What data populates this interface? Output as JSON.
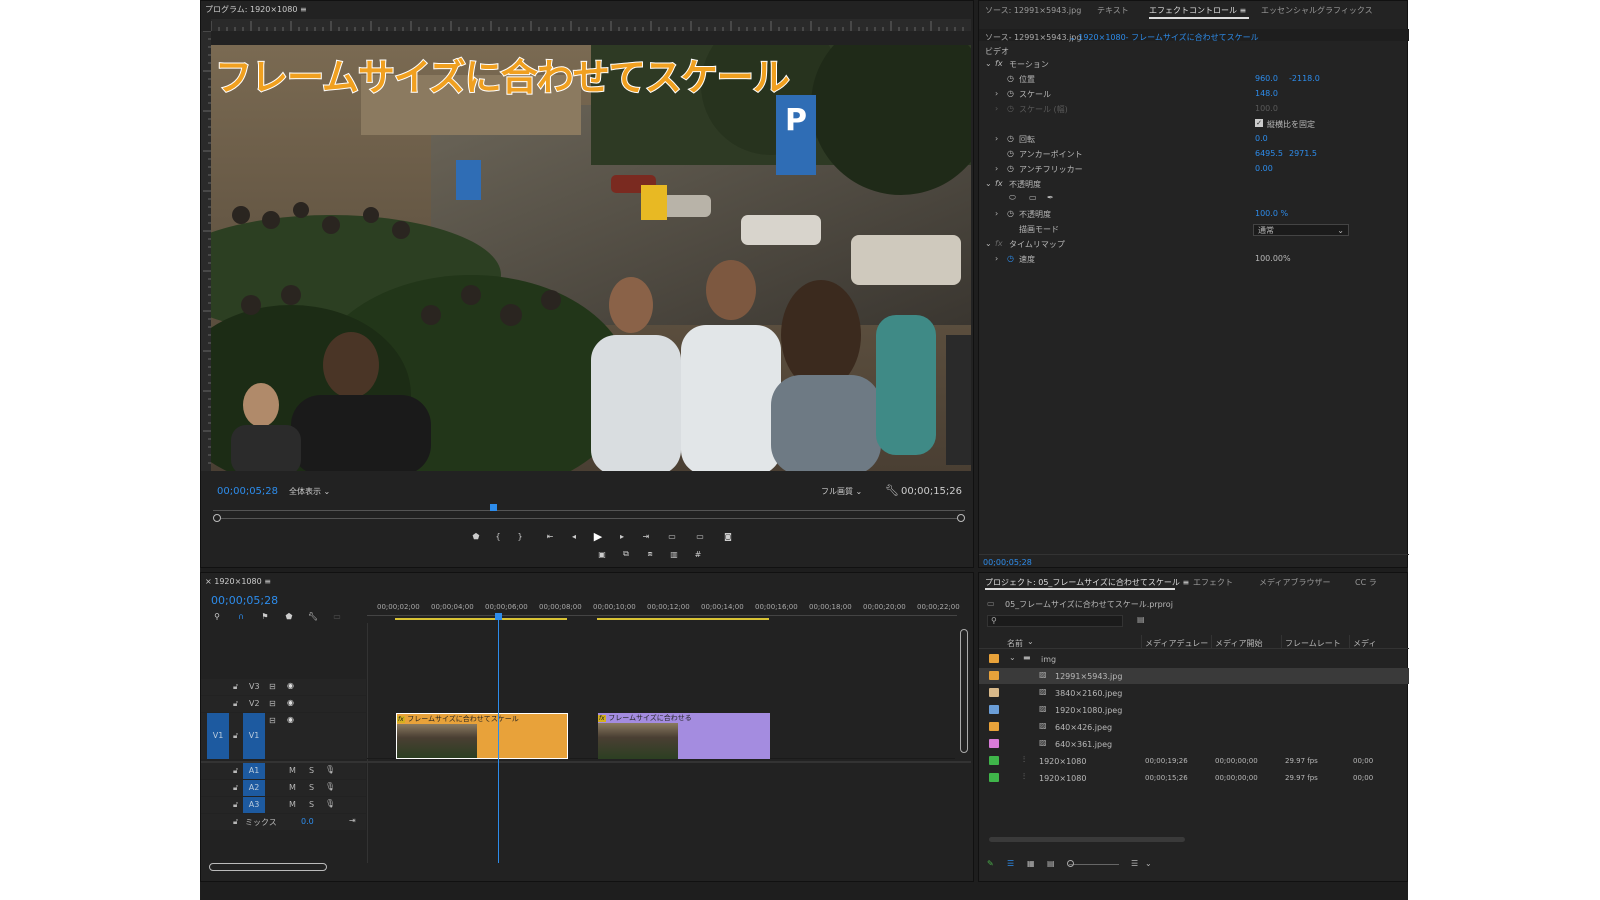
{
  "program": {
    "title": "プログラム: 1920×1080",
    "overlay_text": "フレームサイズに合わせてスケール",
    "timecode": "00;00;05;28",
    "fit_dropdown": "全体表示",
    "quality_dropdown": "フル画質",
    "duration": "00;00;15;26",
    "transport": [
      "marker-icon",
      "in-point-icon",
      "out-point-icon",
      "go-to-in-icon",
      "step-back-icon",
      "play-icon",
      "step-forward-icon",
      "go-to-out-icon",
      "insert-icon",
      "overwrite-icon",
      "export-frame-icon"
    ],
    "transport_row2": [
      "safe-margins-icon",
      "lift-icon",
      "extract-icon",
      "compare-icon",
      "grid-icon"
    ]
  },
  "right_tabs": {
    "source": "ソース: 12991×5943.jpg",
    "text": "テキスト",
    "effect_control": "エフェクトコントロール",
    "essential": "エッセンシャルグラフィックス"
  },
  "effect_controls": {
    "source_label": "ソース- 12991×5943.jpg",
    "sequence_label": "1920×1080- フレームサイズに合わせてスケール",
    "section_video": "ビデオ",
    "motion": "モーション",
    "position_label": "位置",
    "position_x": "960.0",
    "position_y": "-2118.0",
    "scale_label": "スケール",
    "scale_value": "148.0",
    "scale_width_label": "スケール (幅)",
    "scale_width_value": "100.0",
    "uniform_label": "縦横比を固定",
    "rotation_label": "回転",
    "rotation_value": "0.0",
    "anchor_label": "アンカーポイント",
    "anchor_x": "6495.5",
    "anchor_y": "2971.5",
    "antiflicker_label": "アンチフリッカー",
    "antiflicker_value": "0.00",
    "opacity_group": "不透明度",
    "opacity_label": "不透明度",
    "opacity_value": "100.0 %",
    "blend_label": "描画モード",
    "blend_value": "通常",
    "timeremap": "タイムリマップ",
    "speed_label": "速度",
    "speed_value": "100.00%",
    "footer_timecode": "00;00;05;28"
  },
  "timeline": {
    "tab": "1920×1080",
    "timecode": "00;00;05;28",
    "ruler": [
      "00;00;02;00",
      "00;00;04;00",
      "00;00;06;00",
      "00;00;08;00",
      "00;00;10;00",
      "00;00;12;00",
      "00;00;14;00",
      "00;00;16;00",
      "00;00;18;00",
      "00;00;20;00",
      "00;00;22;00"
    ],
    "tracks": {
      "v3": "V3",
      "v2": "V2",
      "v1": "V1",
      "v1src": "V1",
      "a1": "A1",
      "a2": "A2",
      "a3": "A3",
      "m": "M",
      "s": "S",
      "mix": "ミックス",
      "mix_value": "0.0"
    },
    "clip1": "フレームサイズに合わせてスケール",
    "clip2": "フレームサイズに合わせる",
    "fx": "fx",
    "colors": {
      "clip1": "#e8a23a",
      "clip2": "#a48ce0",
      "playhead": "#2d8ceb"
    }
  },
  "project": {
    "tab": "プロジェクト: 05_フレームサイズに合わせてスケール",
    "tab_effects": "エフェクト",
    "tab_media": "メディアブラウザー",
    "tab_cc": "CC ラ",
    "file": "05_フレームサイズに合わせてスケール.prproj",
    "columns": [
      "名前",
      "メディアデュレー",
      "メディア開始",
      "フレームレート",
      "メディ"
    ],
    "folder": "img",
    "items": [
      {
        "name": "12991×5943.jpg",
        "color": "#e8a23a",
        "duration": "",
        "start": "",
        "fps": "",
        "extra": ""
      },
      {
        "name": "3840×2160.jpeg",
        "color": "#d9b98a",
        "duration": "",
        "start": "",
        "fps": "",
        "extra": ""
      },
      {
        "name": "1920×1080.jpeg",
        "color": "#6b9ed8",
        "duration": "",
        "start": "",
        "fps": "",
        "extra": ""
      },
      {
        "name": "640×426.jpeg",
        "color": "#e8a23a",
        "duration": "",
        "start": "",
        "fps": "",
        "extra": ""
      },
      {
        "name": "640×361.jpeg",
        "color": "#d97bd8",
        "duration": "",
        "start": "",
        "fps": "",
        "extra": ""
      }
    ],
    "sequences": [
      {
        "name": "1920×1080",
        "color": "#3fb54a",
        "duration": "00;00;19;26",
        "start": "00;00;00;00",
        "fps": "29.97 fps",
        "extra": "00;00"
      },
      {
        "name": "1920×1080",
        "color": "#3fb54a",
        "duration": "00;00;15;26",
        "start": "00;00;00;00",
        "fps": "29.97 fps",
        "extra": "00;00"
      }
    ]
  }
}
